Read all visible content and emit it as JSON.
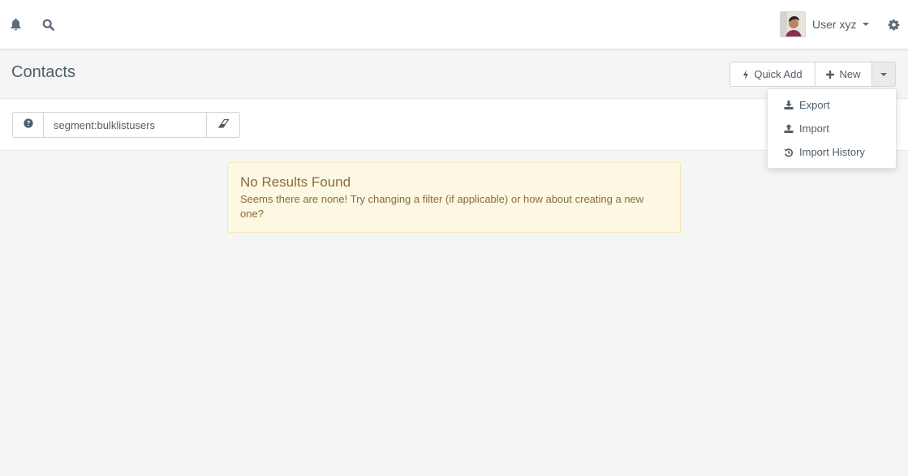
{
  "navbar": {
    "user_name": "User xyz",
    "icons": [
      "bell-icon",
      "search-icon",
      "gear-icon"
    ]
  },
  "page": {
    "title": "Contacts"
  },
  "toolbar": {
    "quick_add_label": "Quick Add",
    "new_label": "New"
  },
  "dropdown": {
    "items": [
      {
        "label": "Export",
        "icon": "download-icon"
      },
      {
        "label": "Import",
        "icon": "upload-icon"
      },
      {
        "label": "Import History",
        "icon": "history-icon"
      }
    ]
  },
  "filter": {
    "search_value": "segment:bulklistusers"
  },
  "alert": {
    "title": "No Results Found",
    "text": "Seems there are none! Try changing a filter (if applicable) or how about creating a new one?"
  },
  "colors": {
    "alert_bg": "#fcf8e3",
    "alert_text": "#8a6d3b",
    "text": "#4e5e6a"
  }
}
